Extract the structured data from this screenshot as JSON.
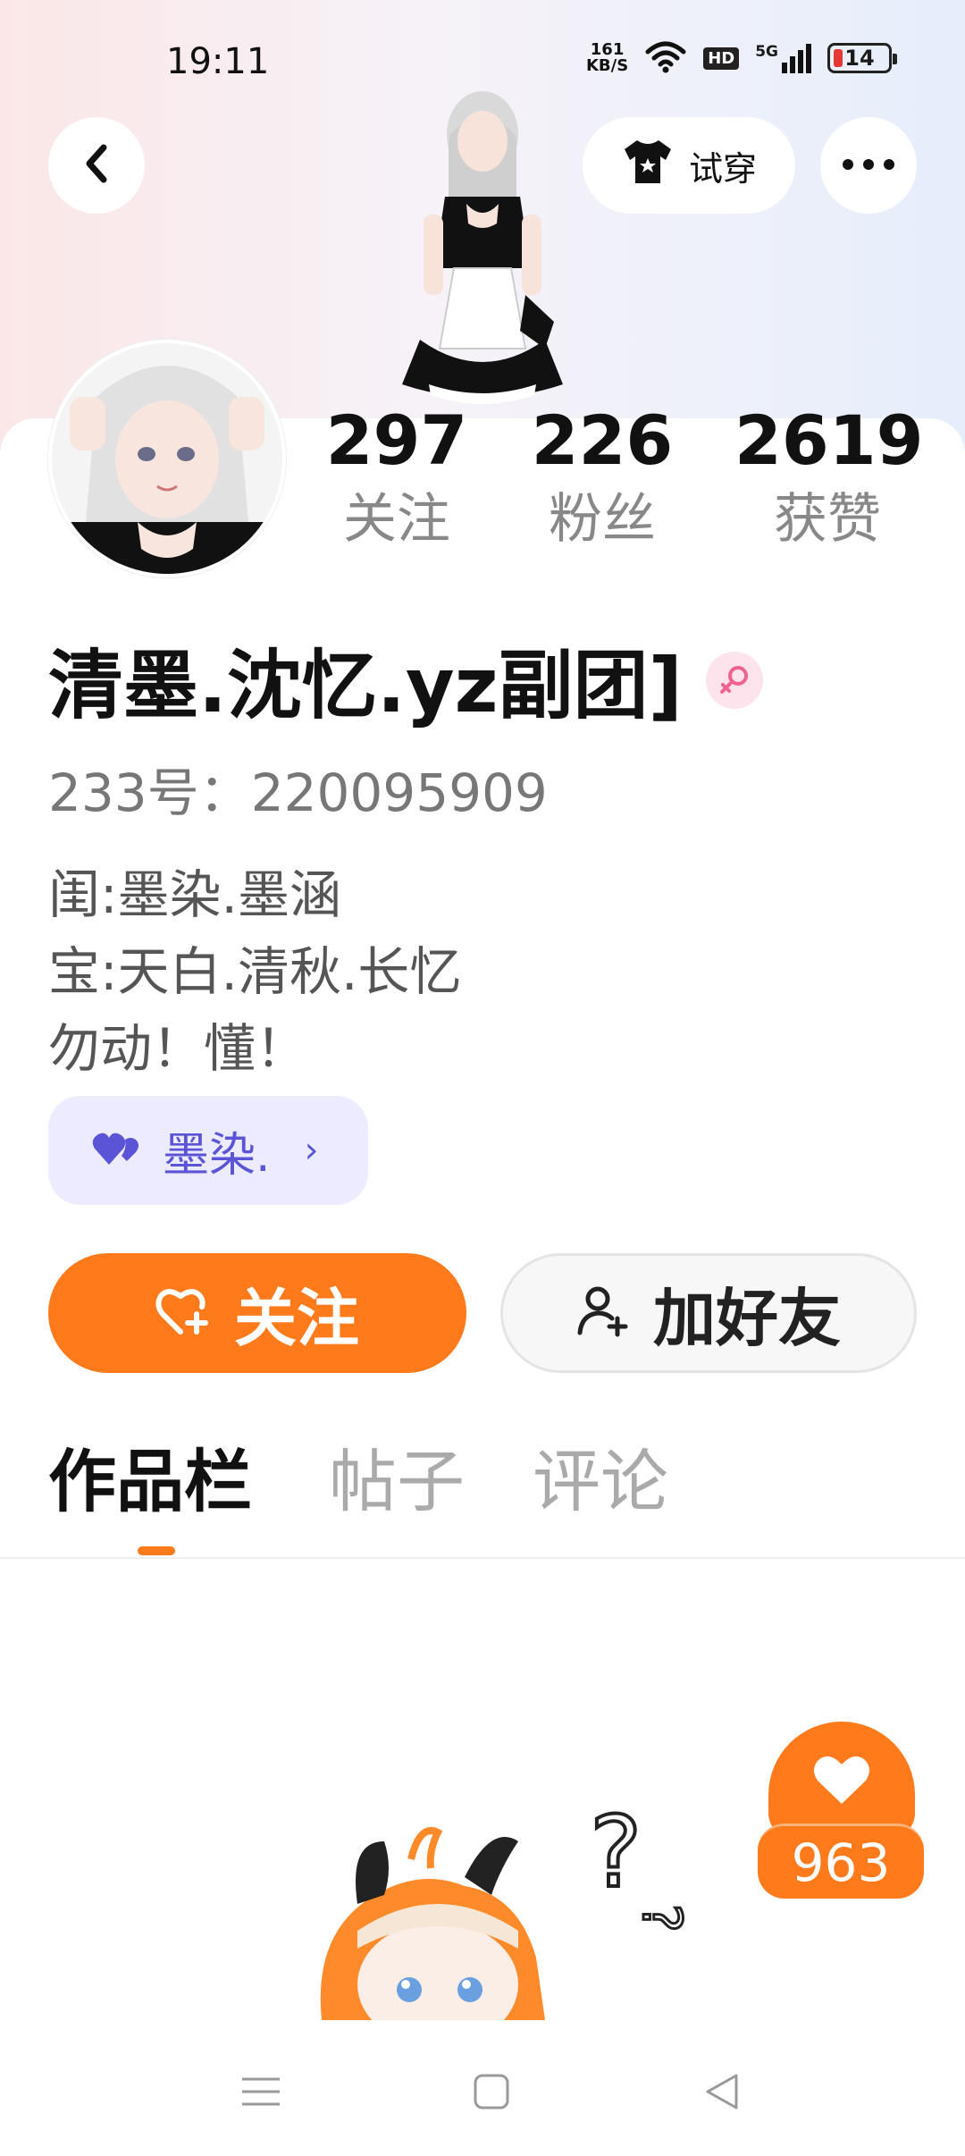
{
  "status_bar": {
    "time": "19:11",
    "net_speed_value": "161",
    "net_speed_unit": "KB/S",
    "hd": "HD",
    "signal": "5G",
    "battery": "14"
  },
  "header": {
    "tryon_label": "试穿"
  },
  "stats": [
    {
      "value": "297",
      "label": "关注"
    },
    {
      "value": "226",
      "label": "粉丝"
    },
    {
      "value": "2619",
      "label": "获赞"
    }
  ],
  "profile": {
    "username": "清墨.沈忆.yz副团]",
    "uid": "233号：220095909",
    "bio": [
      "闺:墨染.墨涵",
      "宝:天白.清秋.长忆",
      "勿动！懂！"
    ]
  },
  "tag_chip": {
    "label": "墨染."
  },
  "actions": {
    "follow_label": "关注",
    "add_friend_label": "加好友"
  },
  "tabs": [
    {
      "label": "作品栏",
      "active": true
    },
    {
      "label": "帖子",
      "active": false
    },
    {
      "label": "评论",
      "active": false
    }
  ],
  "likes": {
    "count": "963"
  },
  "colors": {
    "accent": "#ff7a1a",
    "tag_bg": "#ecebff",
    "tag_text": "#5b54d6",
    "gender": "#f06292"
  }
}
